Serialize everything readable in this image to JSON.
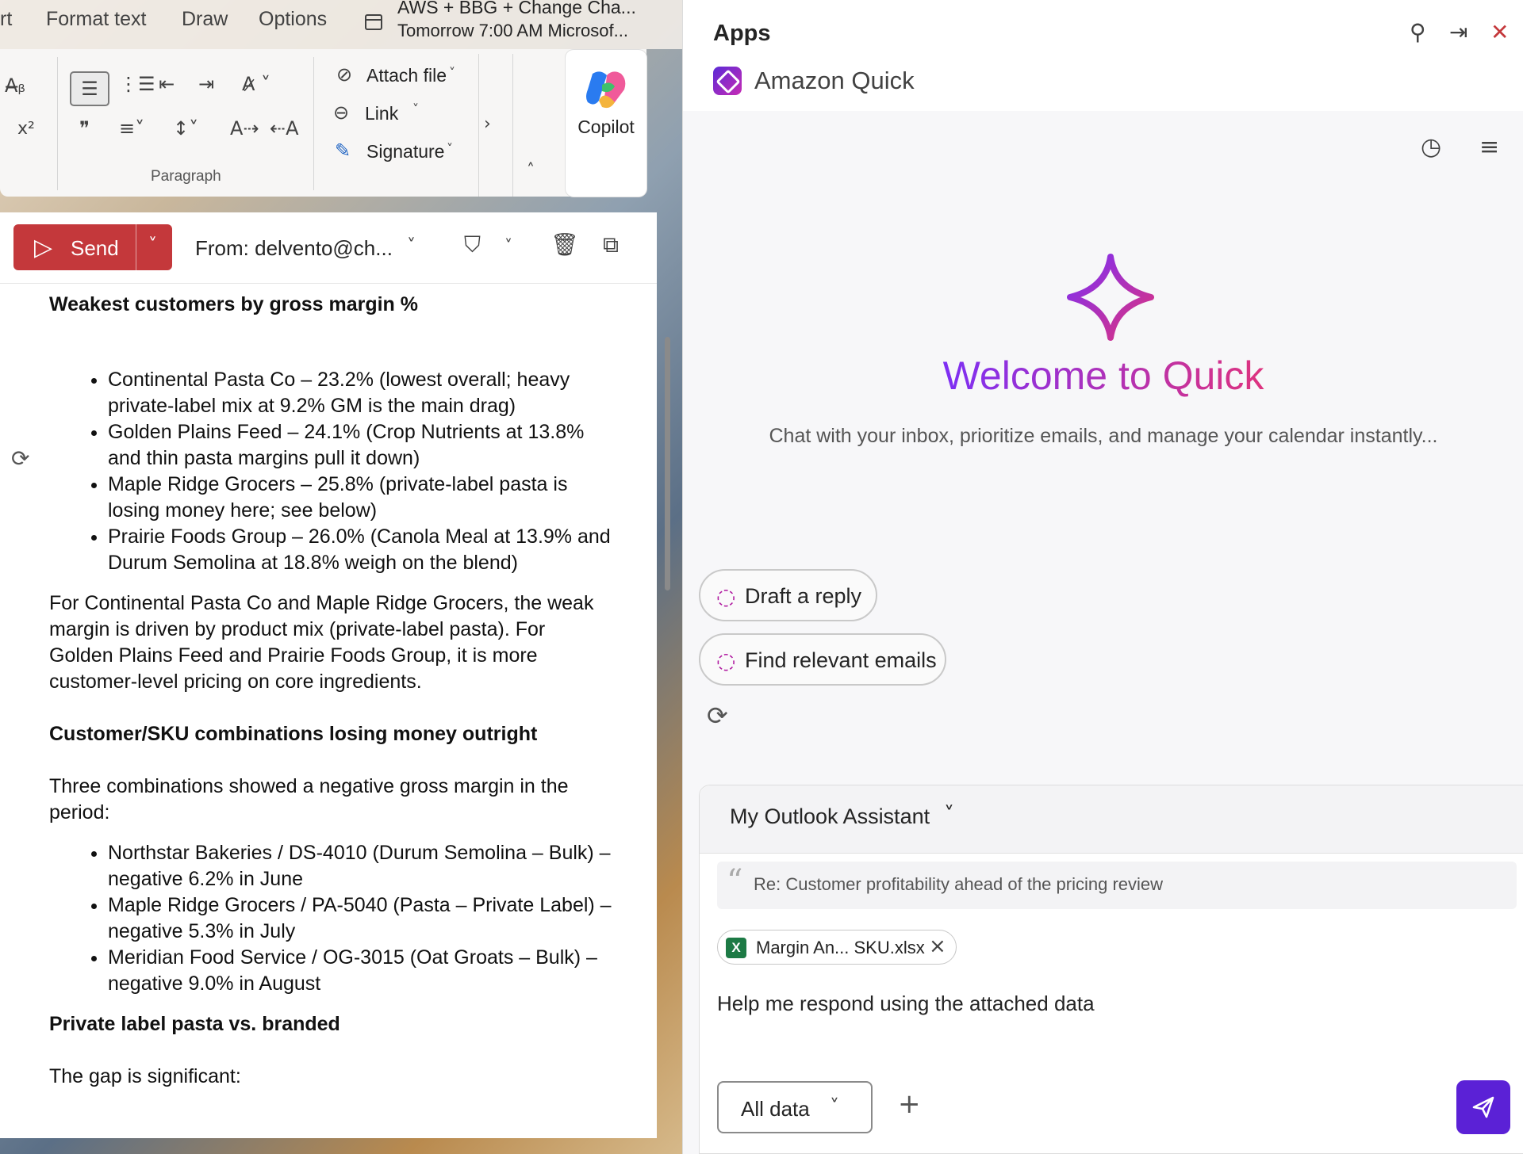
{
  "tabs": [
    "rt",
    "Format text",
    "Draw",
    "Options"
  ],
  "meeting": {
    "title": "AWS + BBG + Change Cha...",
    "time": "Tomorrow 7:00 AM Microsof..."
  },
  "ribbon": {
    "attach": "Attach file",
    "link": "Link",
    "signature": "Signature",
    "group_paragraph": "Paragraph",
    "copilot": "Copilot"
  },
  "compose": {
    "send": "Send",
    "from": "From: delvento@ch...",
    "h1": "Weakest customers by gross margin %",
    "list1": [
      "Continental Pasta Co – 23.2% (lowest overall; heavy private-label mix at 9.2% GM is the main drag)",
      "Golden Plains Feed – 24.1% (Crop Nutrients at 13.8% and thin pasta margins pull it down)",
      "Maple Ridge Grocers – 25.8% (private-label pasta is losing money here; see below)",
      "Prairie Foods Group – 26.0% (Canola Meal at 13.9% and Durum Semolina at 18.8% weigh on the blend)"
    ],
    "p1": "For Continental Pasta Co and Maple Ridge Grocers, the weak margin is driven by product mix (private-label pasta). For Golden Plains Feed and Prairie Foods Group, it is more customer-level pricing on core ingredients.",
    "h2": "Customer/SKU combinations losing money outright",
    "p2": "Three combinations showed a negative gross margin in the period:",
    "list2": [
      "Northstar Bakeries / DS-4010 (Durum Semolina – Bulk) – negative 6.2% in June",
      "Maple Ridge Grocers / PA-5040 (Pasta – Private Label) – negative 5.3% in July",
      "Meridian Food Service / OG-3015 (Oat Groats – Bulk) – negative 9.0% in August"
    ],
    "h3": "Private label pasta vs. branded",
    "p3": "The gap is significant:"
  },
  "apps": {
    "title": "Apps",
    "app_name": "Amazon Quick",
    "welcome": "Welcome to Quick",
    "subtitle": "Chat with your inbox, prioritize emails, and manage your calendar instantly...",
    "suggestions": [
      "Draft a reply",
      "Find relevant emails"
    ],
    "assistant": "My Outlook Assistant",
    "quote": "Re: Customer profitability ahead of the pricing review",
    "attachment": "Margin An... SKU.xlsx",
    "attachment_badge": "X",
    "prompt": "Help me respond using the attached data",
    "scope": "All data"
  },
  "icons": [
    "calendar-icon",
    "spelling-icon",
    "superscript-icon",
    "bullets-icon",
    "numbering-icon",
    "outdent-icon",
    "indent-icon",
    "styles-icon",
    "quote-icon",
    "align-icon",
    "line-spacing-icon",
    "ltr-icon",
    "rtl-icon",
    "paperclip-icon",
    "link-icon",
    "signature-icon",
    "chevron-right-icon",
    "chevron-up-icon",
    "copilot-logo",
    "send-icon",
    "chevron-down-icon",
    "sensitivity-icon",
    "delete-icon",
    "popout-icon",
    "loop-icon",
    "pin-icon",
    "dock-icon",
    "close-icon",
    "quick-logo",
    "history-icon",
    "menu-icon",
    "sparkle-icon",
    "chat-sparkle-icon",
    "refresh-icon",
    "quote-mark-icon",
    "excel-icon",
    "plus-icon",
    "send-arrow-icon"
  ],
  "colors": {
    "send": "#c4383b",
    "accent_purple": "#5b21d6",
    "welcome_start": "#7b2ff7",
    "welcome_end": "#e0337c"
  }
}
